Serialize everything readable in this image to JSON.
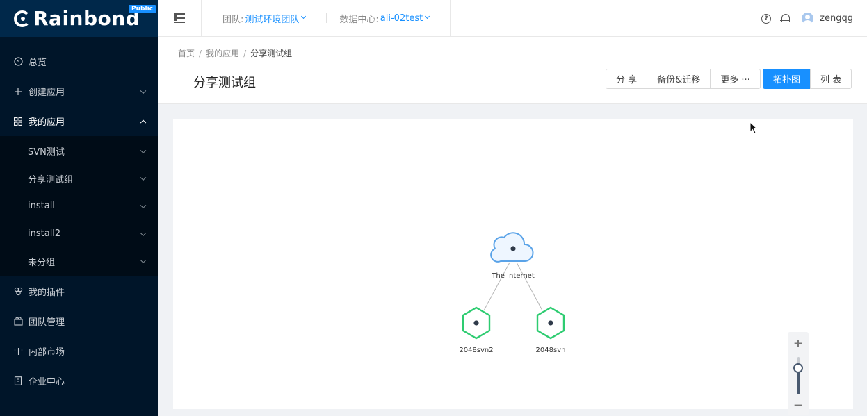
{
  "brand": {
    "name": "Rainbond",
    "badge": "Public"
  },
  "sidebar": {
    "items": [
      {
        "label": "总览",
        "icon": "dashboard-icon"
      },
      {
        "label": "创建应用",
        "icon": "plus-icon"
      },
      {
        "label": "我的应用",
        "icon": "apps-grid-icon"
      },
      {
        "label": "我的插件",
        "icon": "plugin-icon"
      },
      {
        "label": "团队管理",
        "icon": "team-icon"
      },
      {
        "label": "内部市场",
        "icon": "market-icon"
      },
      {
        "label": "企业中心",
        "icon": "enterprise-icon"
      }
    ],
    "my_apps_children": [
      {
        "label": "SVN测试"
      },
      {
        "label": "分享测试组"
      },
      {
        "label": "install"
      },
      {
        "label": "install2"
      },
      {
        "label": "未分组"
      }
    ]
  },
  "header": {
    "team_label": "团队:",
    "team_value": "测试环境团队",
    "dc_label": "数据中心:",
    "dc_value": "ali-02test",
    "help_glyph": "?",
    "username": "zengqg"
  },
  "breadcrumb": {
    "home": "首页",
    "apps": "我的应用",
    "current": "分享测试组"
  },
  "page": {
    "title": "分享测试组",
    "actions": {
      "share": "分 享",
      "backup": "备份&迁移",
      "more": "更多 ···"
    },
    "views": {
      "topology": "拓扑图",
      "list": "列 表"
    }
  },
  "topology": {
    "nodes": [
      {
        "id": "internet",
        "label": "The Internet",
        "type": "cloud"
      },
      {
        "id": "svn2",
        "label": "2048svn2",
        "type": "service"
      },
      {
        "id": "svn",
        "label": "2048svn",
        "type": "service"
      }
    ],
    "edges": [
      {
        "from": "internet",
        "to": "svn2"
      },
      {
        "from": "internet",
        "to": "svn"
      }
    ],
    "colors": {
      "cloud": "#5aa3e8",
      "service": "#2ecc71",
      "edge": "#b5b5b5"
    }
  },
  "zoom": {
    "plus": "+",
    "minus": "−",
    "level": 0.7
  }
}
